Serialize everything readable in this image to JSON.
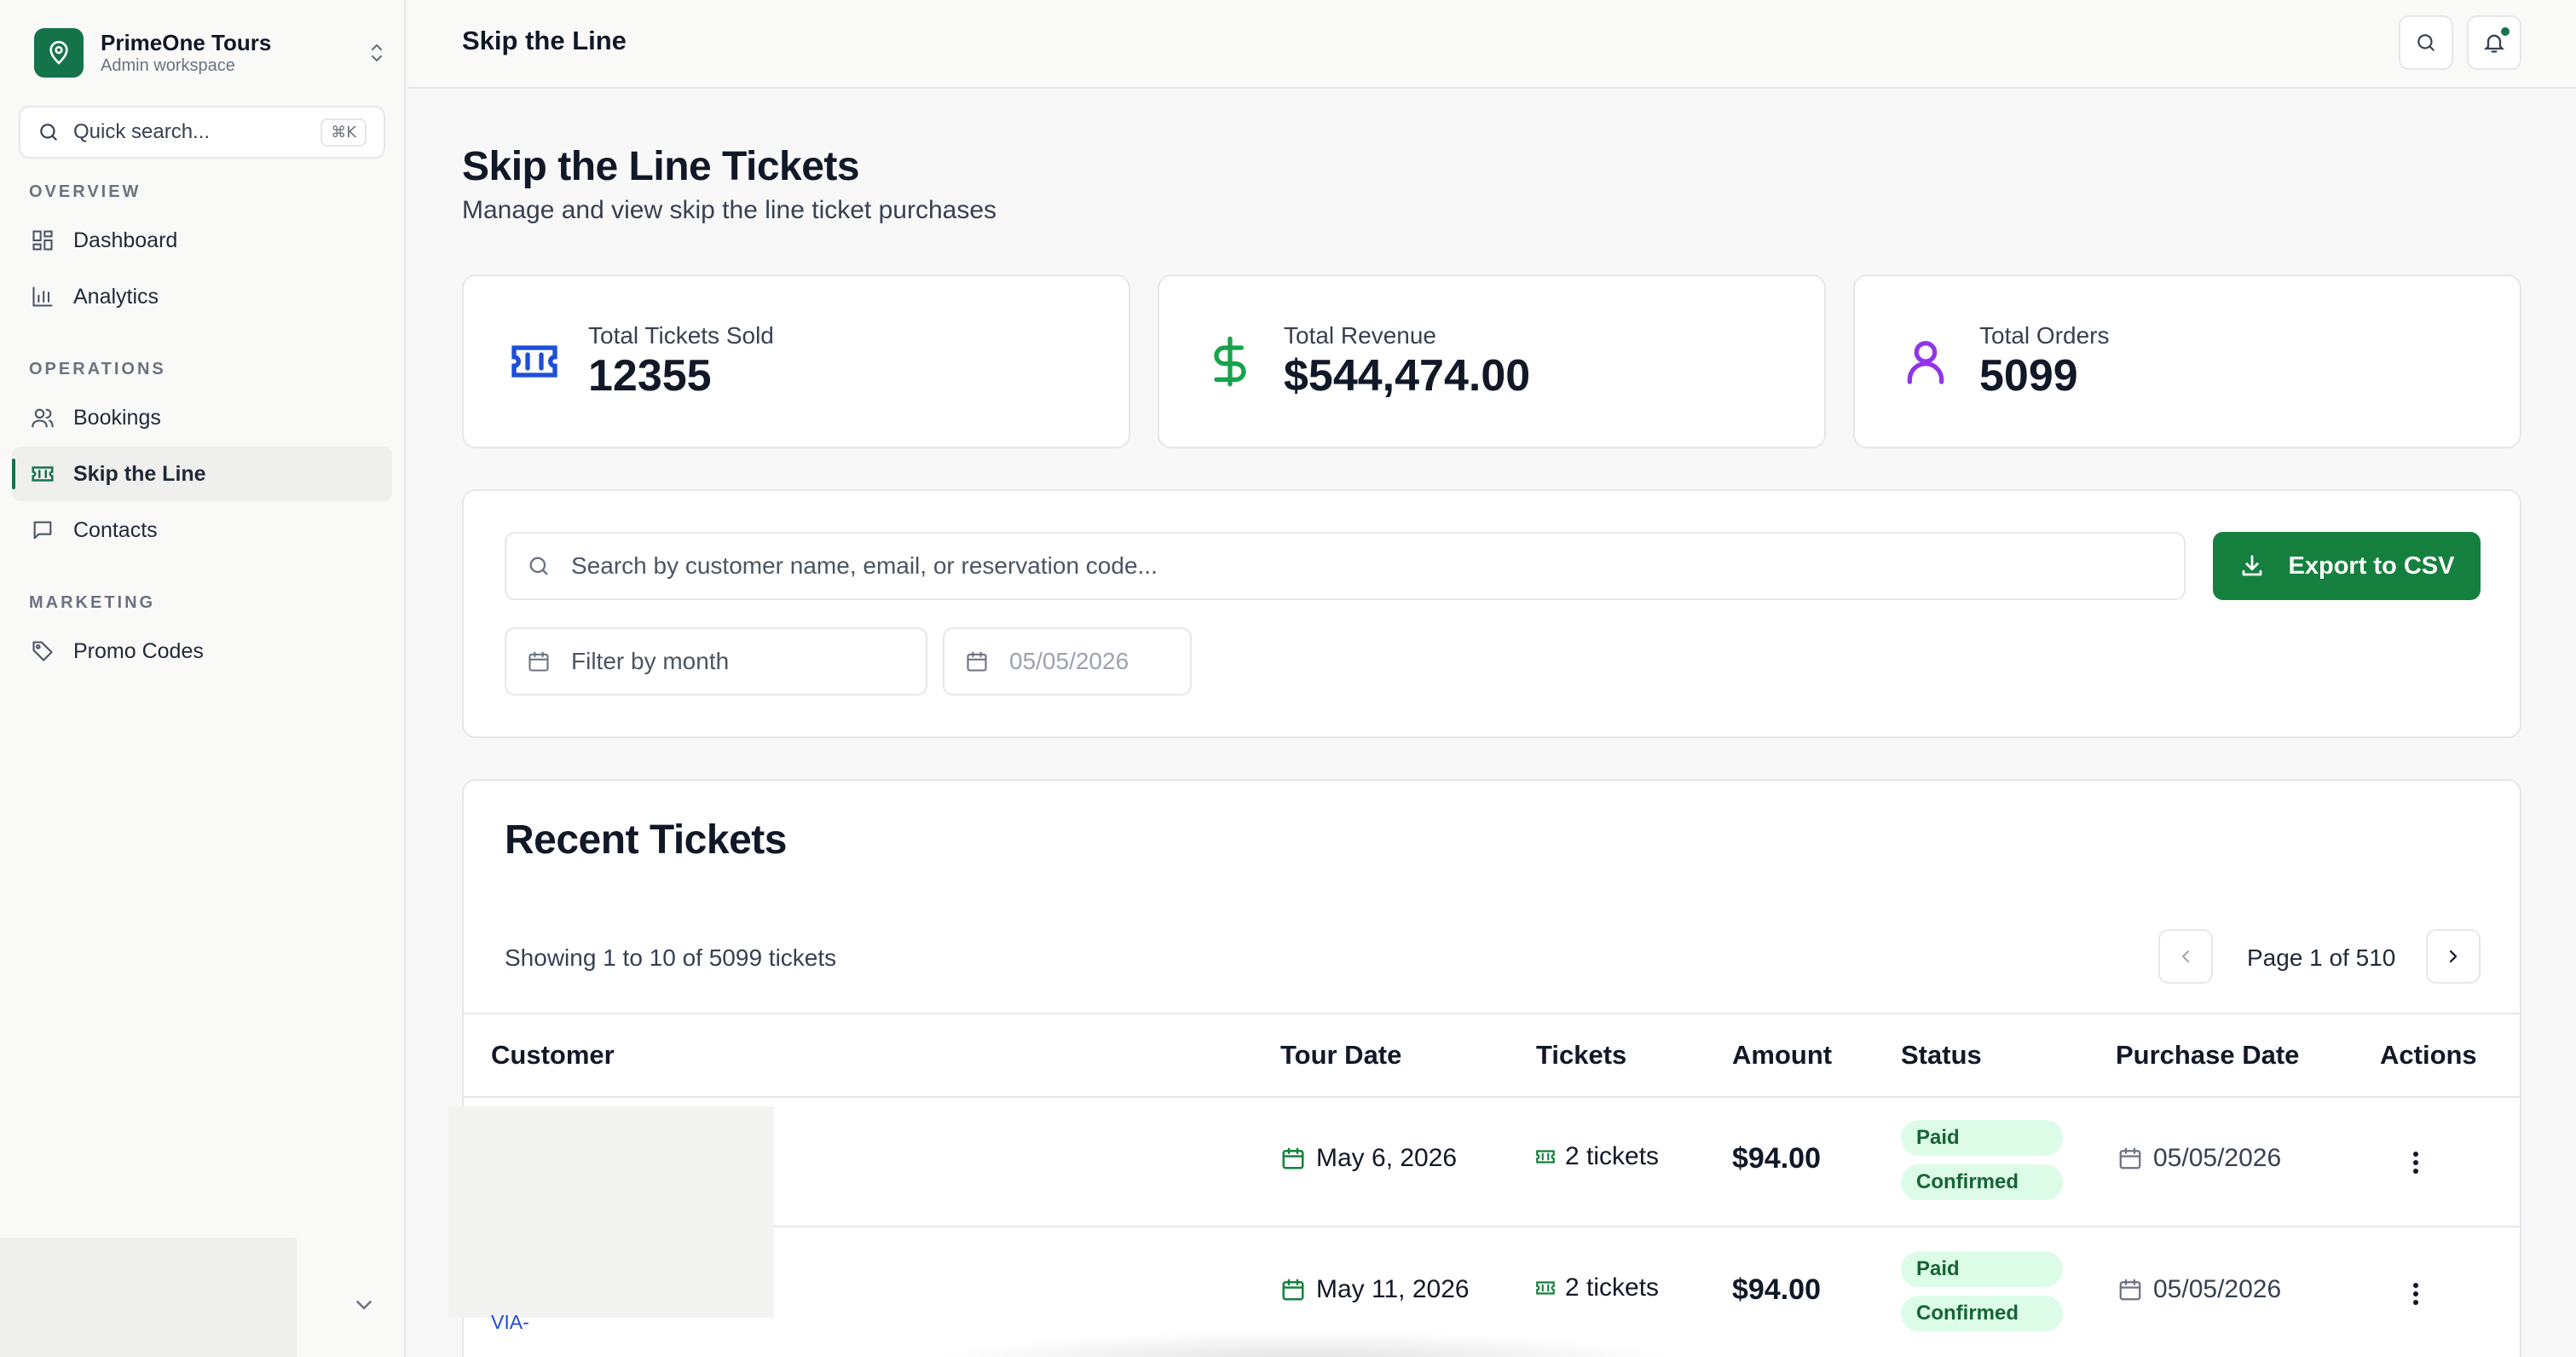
{
  "sidebar": {
    "brand_name": "PrimeOne Tours",
    "brand_sub": "Admin workspace",
    "quick_search_placeholder": "Quick search...",
    "quick_search_shortcut": "⌘K",
    "sections": [
      {
        "label": "OVERVIEW",
        "items": [
          {
            "label": "Dashboard",
            "icon": "dashboard-icon",
            "active": false
          },
          {
            "label": "Analytics",
            "icon": "bar-chart-icon",
            "active": false
          }
        ]
      },
      {
        "label": "OPERATIONS",
        "items": [
          {
            "label": "Bookings",
            "icon": "users-icon",
            "active": false
          },
          {
            "label": "Skip the Line",
            "icon": "ticket-icon",
            "active": true
          },
          {
            "label": "Contacts",
            "icon": "message-icon",
            "active": false
          }
        ]
      },
      {
        "label": "MARKETING",
        "items": [
          {
            "label": "Promo Codes",
            "icon": "tag-icon",
            "active": false
          }
        ]
      }
    ]
  },
  "topbar": {
    "title": "Skip the Line"
  },
  "page": {
    "title": "Skip the Line Tickets",
    "subtitle": "Manage and view skip the line ticket purchases"
  },
  "stats": [
    {
      "label": "Total Tickets Sold",
      "value": "12355",
      "icon": "ticket-icon",
      "color": "#1d4ed8"
    },
    {
      "label": "Total Revenue",
      "value": "$544,474.00",
      "icon": "dollar-icon",
      "color": "#16a34a"
    },
    {
      "label": "Total Orders",
      "value": "5099",
      "icon": "user-icon",
      "color": "#9333ea"
    }
  ],
  "filters": {
    "search_placeholder": "Search by customer name, email, or reservation code...",
    "export_label": "Export to CSV",
    "month_placeholder": "Filter by month",
    "date_value": "05/05/2026"
  },
  "recent": {
    "title": "Recent Tickets",
    "showing": "Showing 1 to 10 of 5099 tickets",
    "page_text": "Page 1 of 510",
    "columns": [
      "Customer",
      "Tour Date",
      "Tickets",
      "Amount",
      "Status",
      "Purchase Date",
      "Actions"
    ],
    "rows": [
      {
        "customer": "",
        "tour_date": "May 6, 2026",
        "tickets": "2 tickets",
        "amount": "$94.00",
        "payment": "Paid",
        "status": "Confirmed",
        "purchase_date": "05/05/2026"
      },
      {
        "customer": "VIA-",
        "tour_date": "May 11, 2026",
        "tickets": "2 tickets",
        "amount": "$94.00",
        "payment": "Paid",
        "status": "Confirmed",
        "purchase_date": "05/05/2026"
      }
    ]
  },
  "colors": {
    "accent": "#15734a",
    "export": "#15803d",
    "badge_bg": "#dcfce7",
    "badge_text": "#166534"
  }
}
